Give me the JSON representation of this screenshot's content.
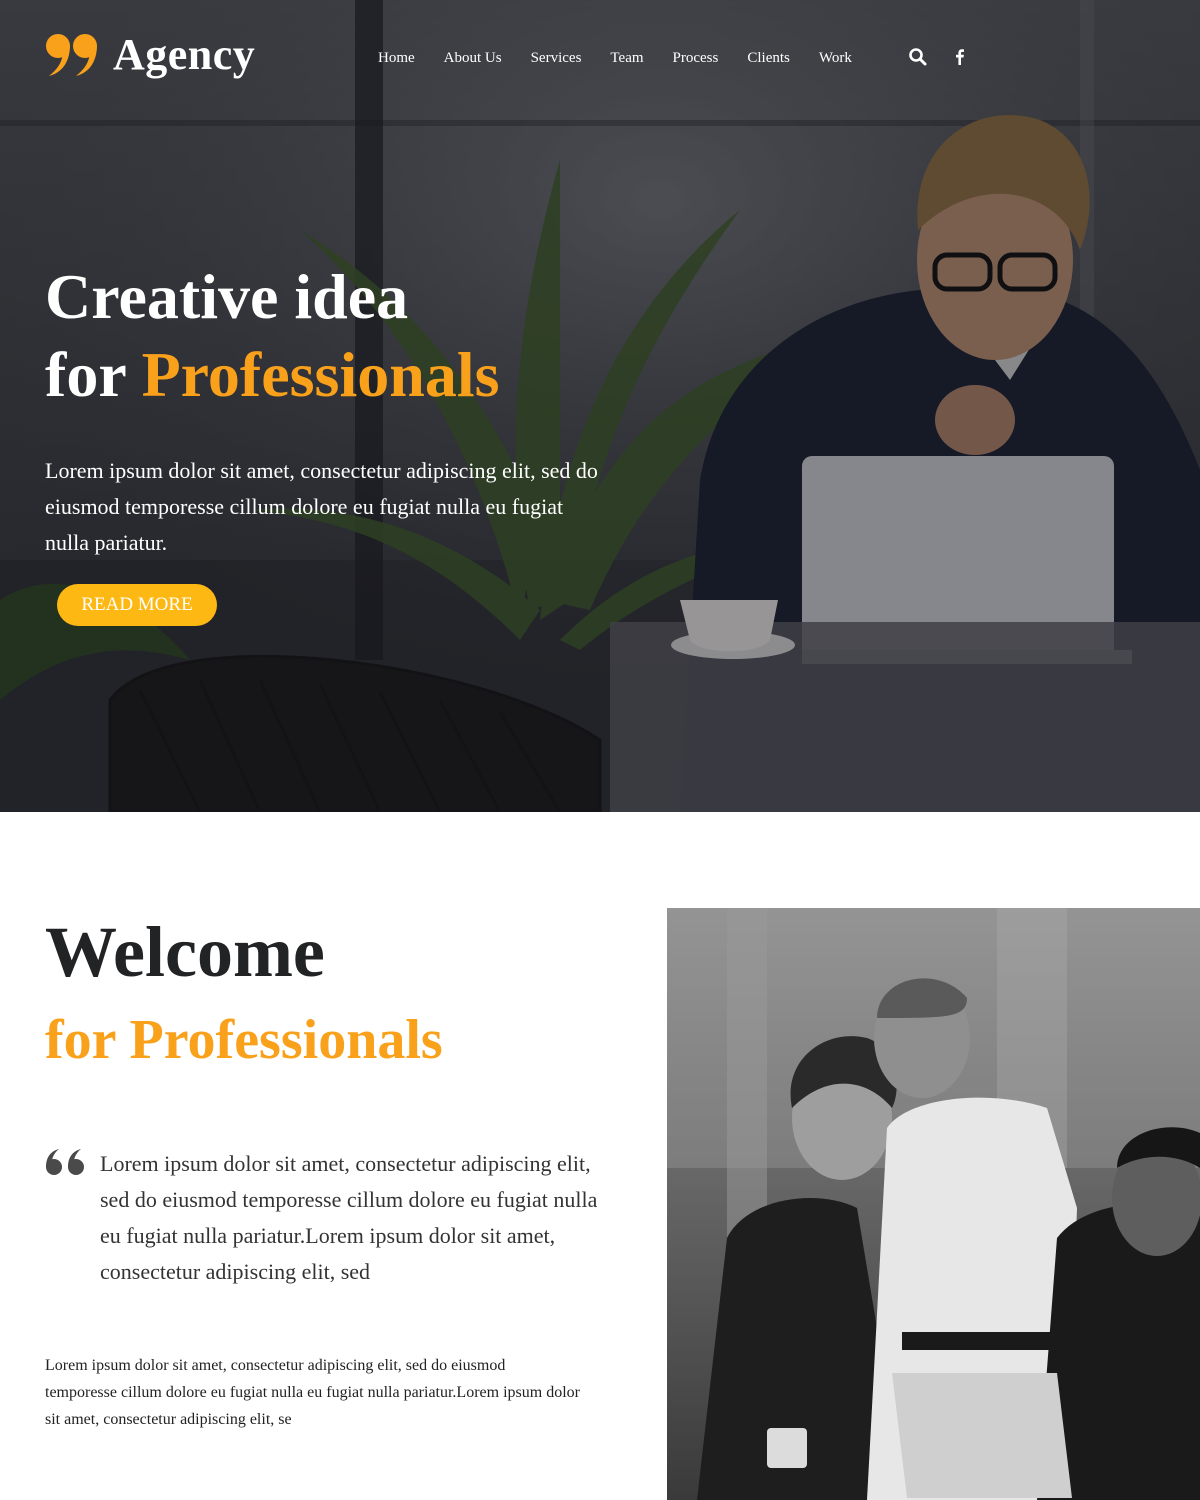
{
  "brand": {
    "name": "Agency",
    "logo_icon": "double-quote-logo-icon",
    "accent_color": "#f9a11b",
    "button_color": "#fdb813"
  },
  "nav": {
    "items": [
      {
        "label": "Home"
      },
      {
        "label": "About Us"
      },
      {
        "label": "Services"
      },
      {
        "label": "Team"
      },
      {
        "label": "Process"
      },
      {
        "label": "Clients"
      },
      {
        "label": "Work"
      }
    ],
    "icons": [
      "search-icon",
      "facebook-icon"
    ]
  },
  "hero": {
    "title_line1": "Creative idea",
    "title_for": "for",
    "title_accent": "Professionals",
    "description": "Lorem ipsum dolor sit amet, consectetur adipiscing elit, sed do eiusmod temporesse cillum dolore eu fugiat nulla eu fugiat nulla pariatur.",
    "button_label": "READ MORE"
  },
  "welcome": {
    "title": "Welcome",
    "subtitle": "for Professionals",
    "quote_icon": "quote-open-icon",
    "quote": "Lorem ipsum dolor sit amet, consectetur adipiscing elit, sed do eiusmod temporesse cillum dolore eu fugiat nulla eu fugiat nulla pariatur.Lorem ipsum dolor sit amet, consectetur adipiscing elit, sed",
    "body": "Lorem ipsum dolor sit amet, consectetur adipiscing elit, sed do eiusmod temporesse cillum dolore eu fugiat nulla eu fugiat nulla pariatur.Lorem ipsum dolor sit amet, consectetur adipiscing elit, se"
  }
}
